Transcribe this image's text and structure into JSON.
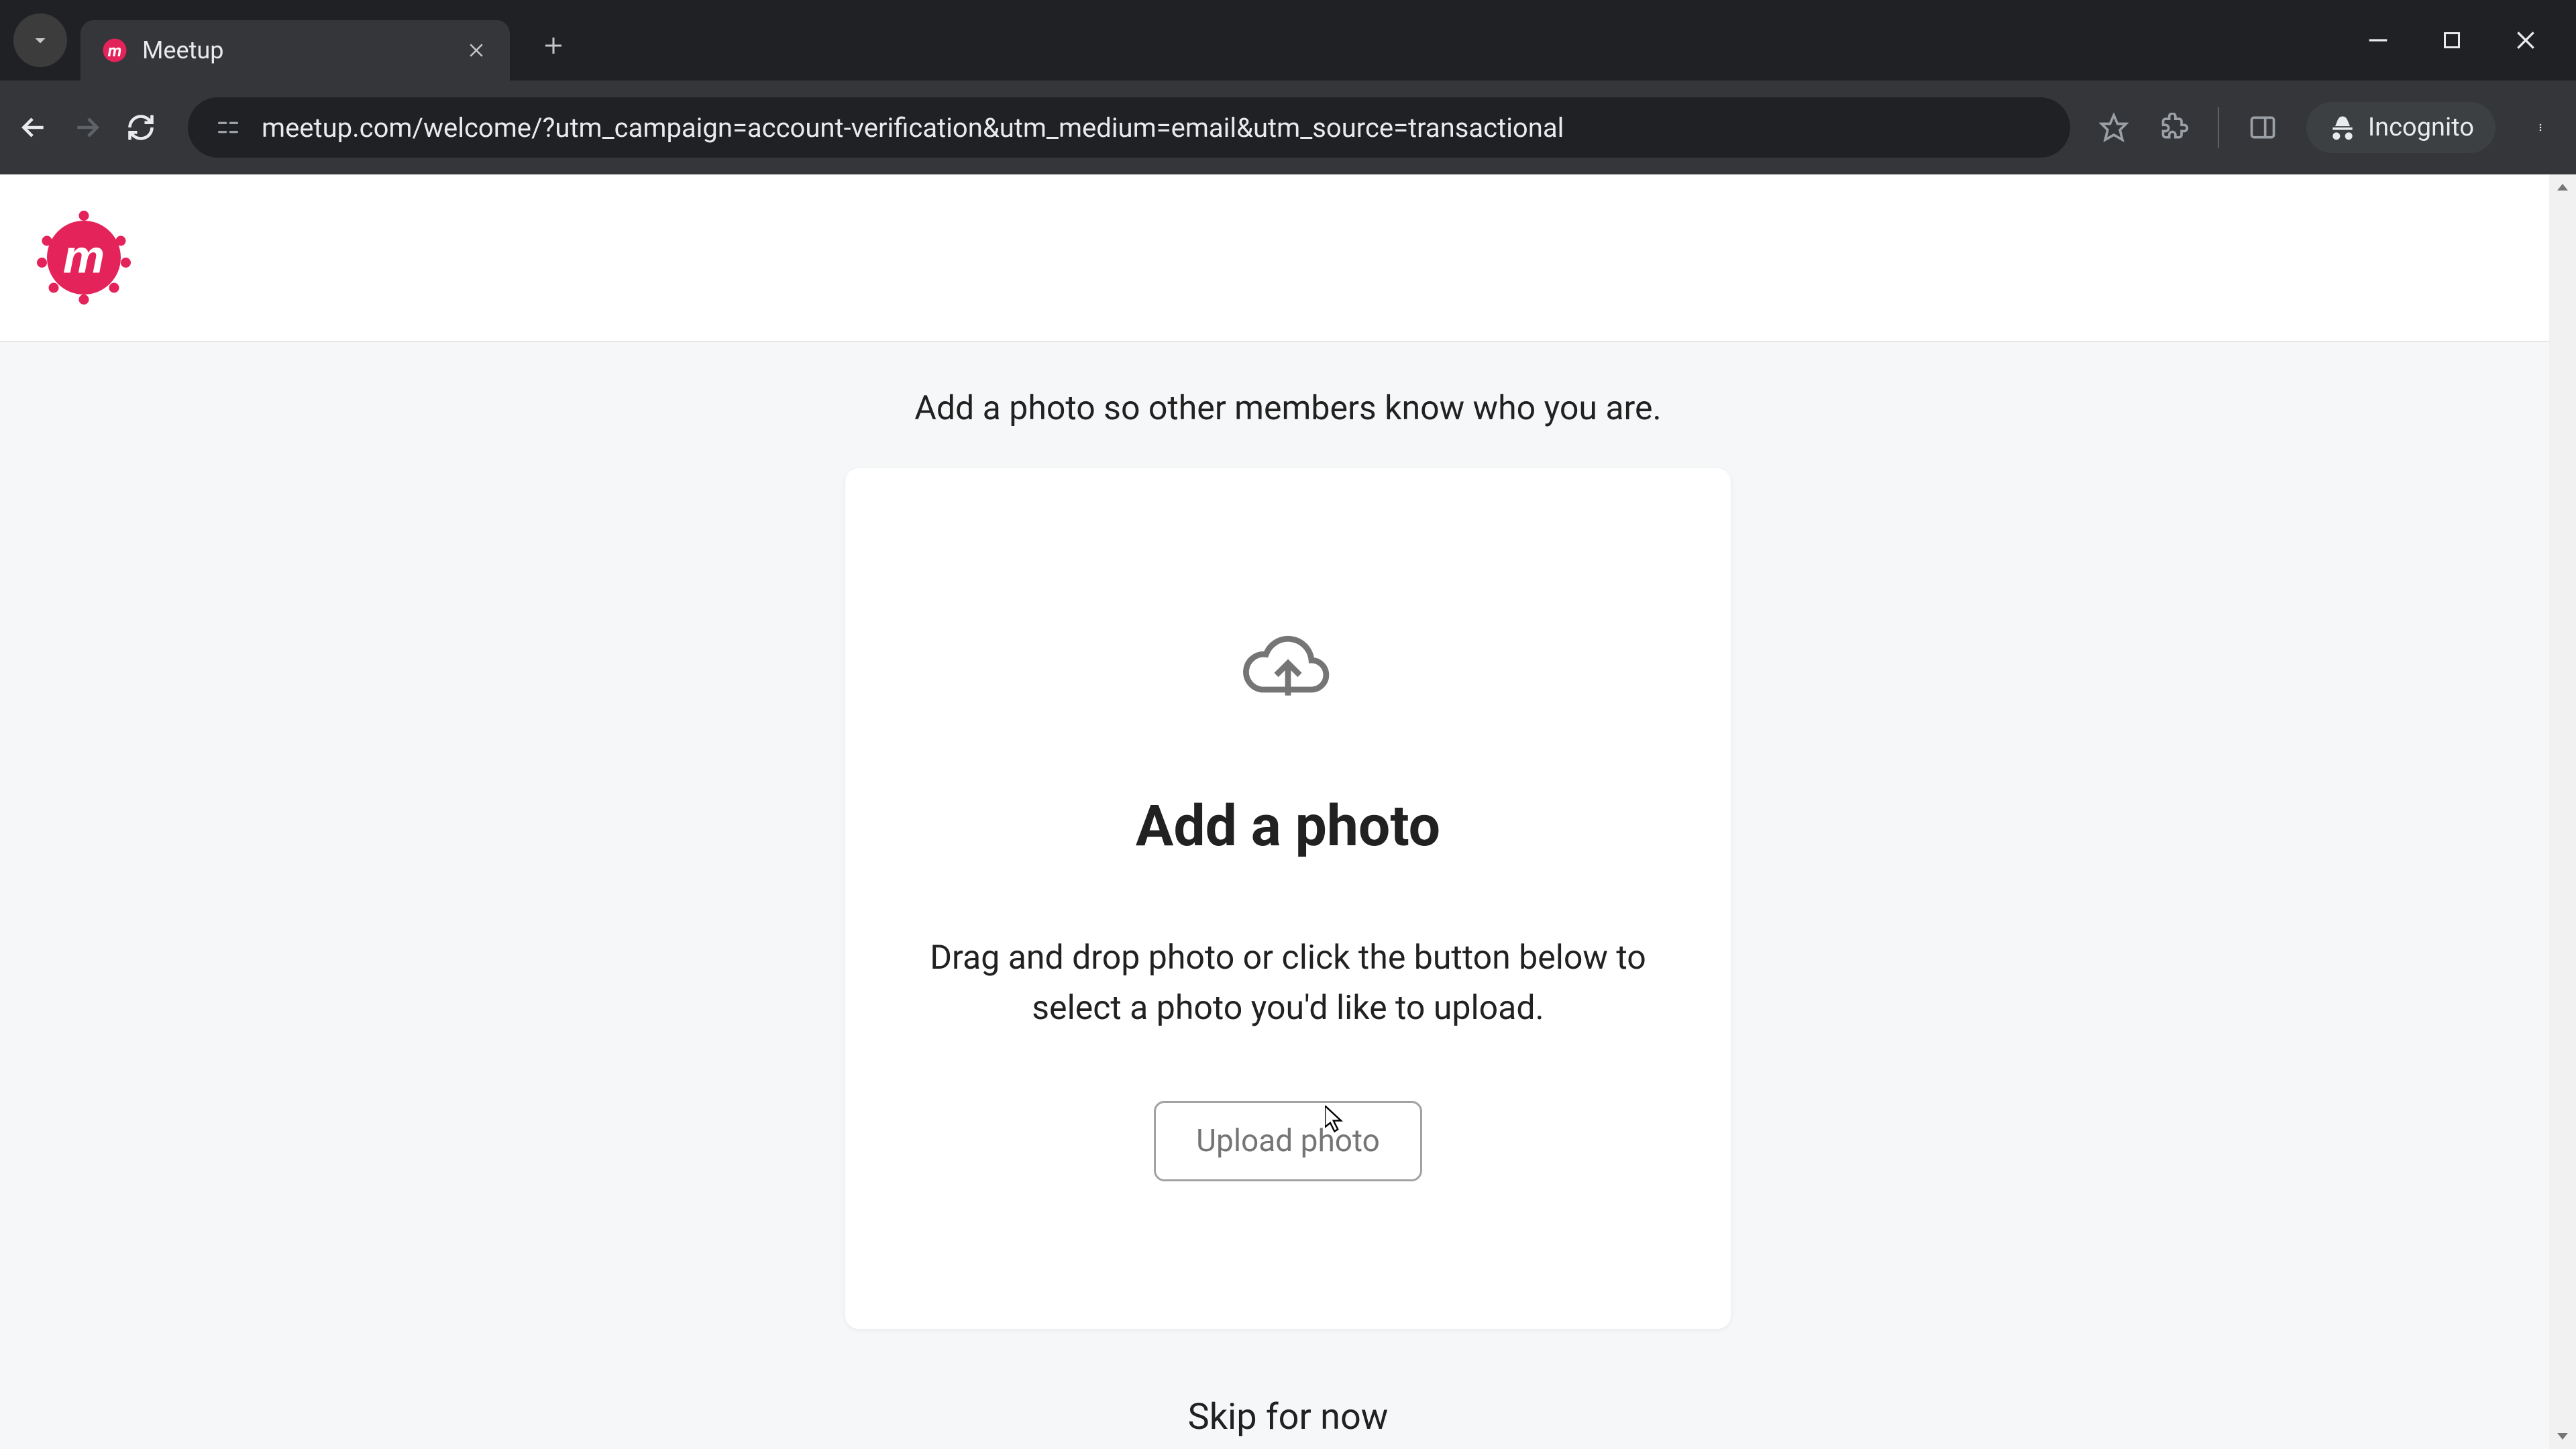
{
  "browser": {
    "tab_title": "Meetup",
    "url": "meetup.com/welcome/?utm_campaign=account-verification&utm_medium=email&utm_source=transactional",
    "incognito_label": "Incognito"
  },
  "page": {
    "intro_text": "Add a photo so other members know who you are.",
    "card_heading": "Add a photo",
    "card_description": "Drag and drop photo or click the button below to select a photo you'd like to upload.",
    "upload_button_label": "Upload photo",
    "skip_label": "Skip for now"
  }
}
